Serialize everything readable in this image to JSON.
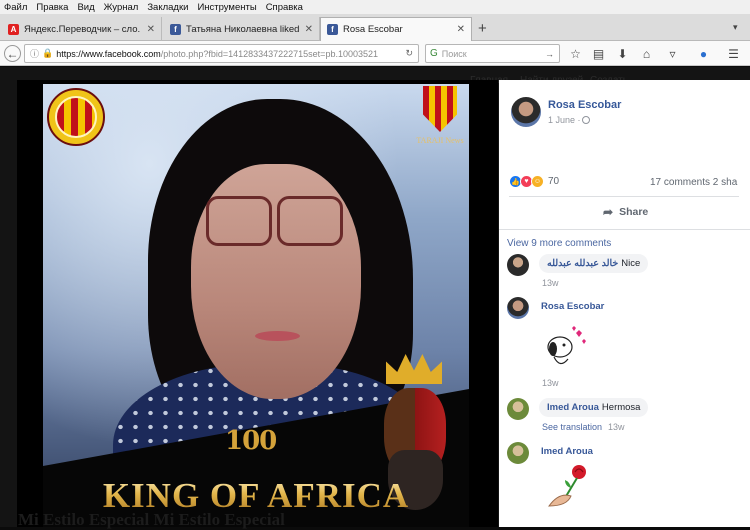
{
  "menubar": {
    "items": [
      "Файл",
      "Правка",
      "Вид",
      "Журнал",
      "Закладки",
      "Инструменты",
      "Справка"
    ]
  },
  "tabs": [
    {
      "title": "Яндекс.Переводчик – сло...",
      "icon": "yandex-translate-icon"
    },
    {
      "title": "Татьяна Николаевна liked...",
      "icon": "facebook-icon"
    },
    {
      "title": "Rosa Escobar",
      "icon": "facebook-icon",
      "active": true
    }
  ],
  "navbar": {
    "url_domain": "https://www.facebook.com",
    "url_rest": "/photo.php?fbid=1412833437222715set=pb.10003521",
    "search_placeholder": "Поиск"
  },
  "fb_bar_ghost": [
    "Главная",
    "Найти друзей",
    "Создать"
  ],
  "photo": {
    "logo_right_text": "TARAJI News",
    "badge_100": "100",
    "headline": "KING OF AFRICA",
    "bottom_overlay": "Mi Estilo Especial Mi Estilo Especial"
  },
  "post": {
    "author": "Rosa Escobar",
    "date": "1 June · ",
    "reactions_count": "70",
    "comments_shares": "17 comments  2 sha",
    "share_label": "Share",
    "view_more": "View 9 more comments"
  },
  "comments": [
    {
      "name": "خالد عبدلله عبدلله",
      "text": "Nice",
      "time": "13w"
    },
    {
      "name": "Rosa Escobar",
      "text": "",
      "time": "13w"
    },
    {
      "name": "Imed Aroua",
      "text": "Hermosa",
      "see_translation": "See translation",
      "time": "13w"
    },
    {
      "name": "Imed Aroua",
      "text": "",
      "time": ""
    }
  ],
  "colors": {
    "fb_blue": "#365899",
    "link": "#4b67a1",
    "gold": "#e2b54a"
  }
}
